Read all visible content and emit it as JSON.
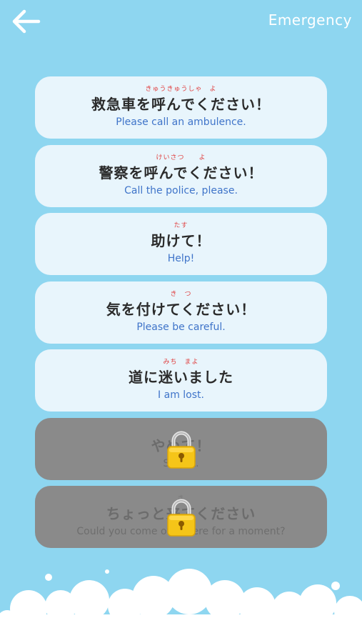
{
  "header": {
    "back_icon": "arrow-left-icon",
    "title": "Emergency"
  },
  "phrases": [
    {
      "furigana": "きゅうきゅうしゃ　よ",
      "jp": "救急車を呼んでください！",
      "en": "Please call an ambulence.",
      "locked": false
    },
    {
      "furigana": "けいさつ　　よ",
      "jp": "警察を呼んでください！",
      "en": "Call the police, please.",
      "locked": false
    },
    {
      "furigana": "たす",
      "jp": "助けて！",
      "en": "Help!",
      "locked": false
    },
    {
      "furigana": "き　つ",
      "jp": "気を付けてください！",
      "en": "Please be careful.",
      "locked": false
    },
    {
      "furigana": "みち　まよ",
      "jp": "道に迷いました",
      "en": "I am lost.",
      "locked": false
    },
    {
      "furigana": "",
      "jp": "やめて！",
      "en": "Stop it.",
      "locked": true
    },
    {
      "furigana": "き",
      "jp": "ちょっと来てください",
      "en": "Could you come over here for a moment?",
      "locked": true
    }
  ],
  "colors": {
    "background": "#8ed6f0",
    "card": "#e8f5fc",
    "card_locked": "#8a8a8a",
    "english_text": "#3f74c9",
    "furigana": "#e04040",
    "lock": "#f5c518"
  }
}
